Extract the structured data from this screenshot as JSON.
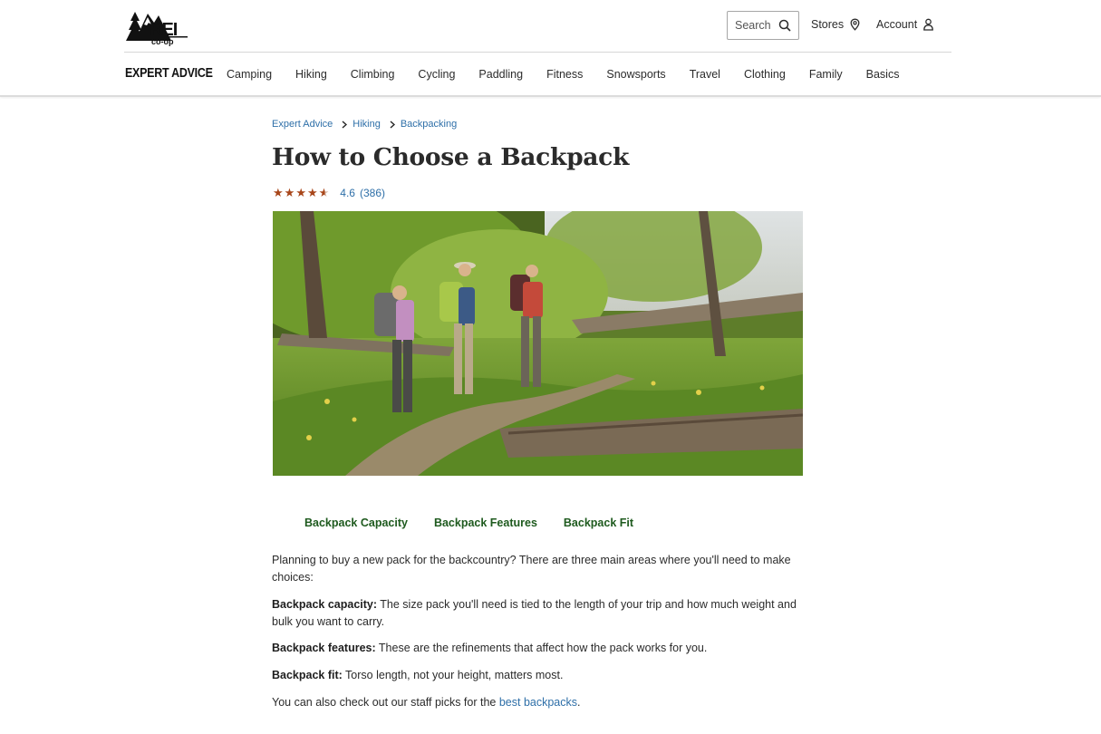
{
  "header": {
    "logo_alt": "REI co-op",
    "search_label": "Search",
    "stores_label": "Stores",
    "account_label": "Account"
  },
  "nav": {
    "brand": "EXPERT ADVICE",
    "items": [
      "Camping",
      "Hiking",
      "Climbing",
      "Cycling",
      "Paddling",
      "Fitness",
      "Snowsports",
      "Travel",
      "Clothing",
      "Family",
      "Basics"
    ]
  },
  "breadcrumb": [
    "Expert Advice",
    "Hiking",
    "Backpacking"
  ],
  "article": {
    "title": "How to Choose a Backpack",
    "rating": {
      "stars": 4.6,
      "value_text": "4.6",
      "count_text": "(386)"
    },
    "tabs": [
      "Backpack Capacity",
      "Backpack Features",
      "Backpack Fit"
    ],
    "intro": "Planning to buy a new pack for the backcountry? There are three main areas where you'll need to make choices:",
    "points": [
      {
        "label": "Backpack capacity:",
        "text": " The size pack you'll need is tied to the length of your trip and how much weight and bulk you want to carry."
      },
      {
        "label": "Backpack features:",
        "text": " These are the refinements that affect how the pack works for you."
      },
      {
        "label": "Backpack fit:",
        "text": " Torso length, not your height, matters most."
      }
    ],
    "closing_prefix": "You can also check out our staff picks for the ",
    "closing_link": "best backpacks",
    "closing_suffix": "."
  },
  "colors": {
    "link": "#2e6fa8",
    "star": "#a8461a",
    "tab": "#1e5a1e"
  }
}
